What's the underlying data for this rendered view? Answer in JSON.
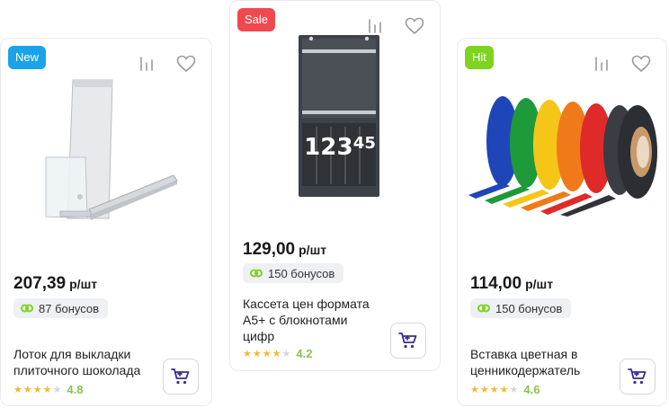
{
  "colors": {
    "new_badge": "#1aa3e8",
    "sale_badge": "#f0484e",
    "hit_badge": "#7ed321",
    "accent": "#3b2d8f",
    "bonus_icon": "#7ed321",
    "star": "#f5b82e"
  },
  "products": [
    {
      "badge": "New",
      "price": "207,39",
      "unit": "р/шт",
      "bonus": "87 бонусов",
      "title_lines": [
        "Лоток для выкладки",
        "плиточного шоколада"
      ],
      "rating": "4.8",
      "stars_filled": 4,
      "icons": [
        "compare-icon",
        "heart-icon",
        "cart-icon",
        "link-icon"
      ]
    },
    {
      "badge": "Sale",
      "price": "129,00",
      "unit": "р/шт",
      "bonus": "150 бонусов",
      "title_lines": [
        "Кассета цен формата",
        "А5+ с блокнотами",
        "цифр"
      ],
      "rating": "4.2",
      "stars_filled": 4,
      "digits": [
        "1",
        "2",
        "3",
        "4",
        "5"
      ]
    },
    {
      "badge": "Hit",
      "price": "114,00",
      "unit": "р/шт",
      "bonus": "150 бонусов",
      "title_lines": [
        "Вставка цветная в",
        "ценникодержатель"
      ],
      "rating": "4.6",
      "stars_filled": 4
    }
  ]
}
